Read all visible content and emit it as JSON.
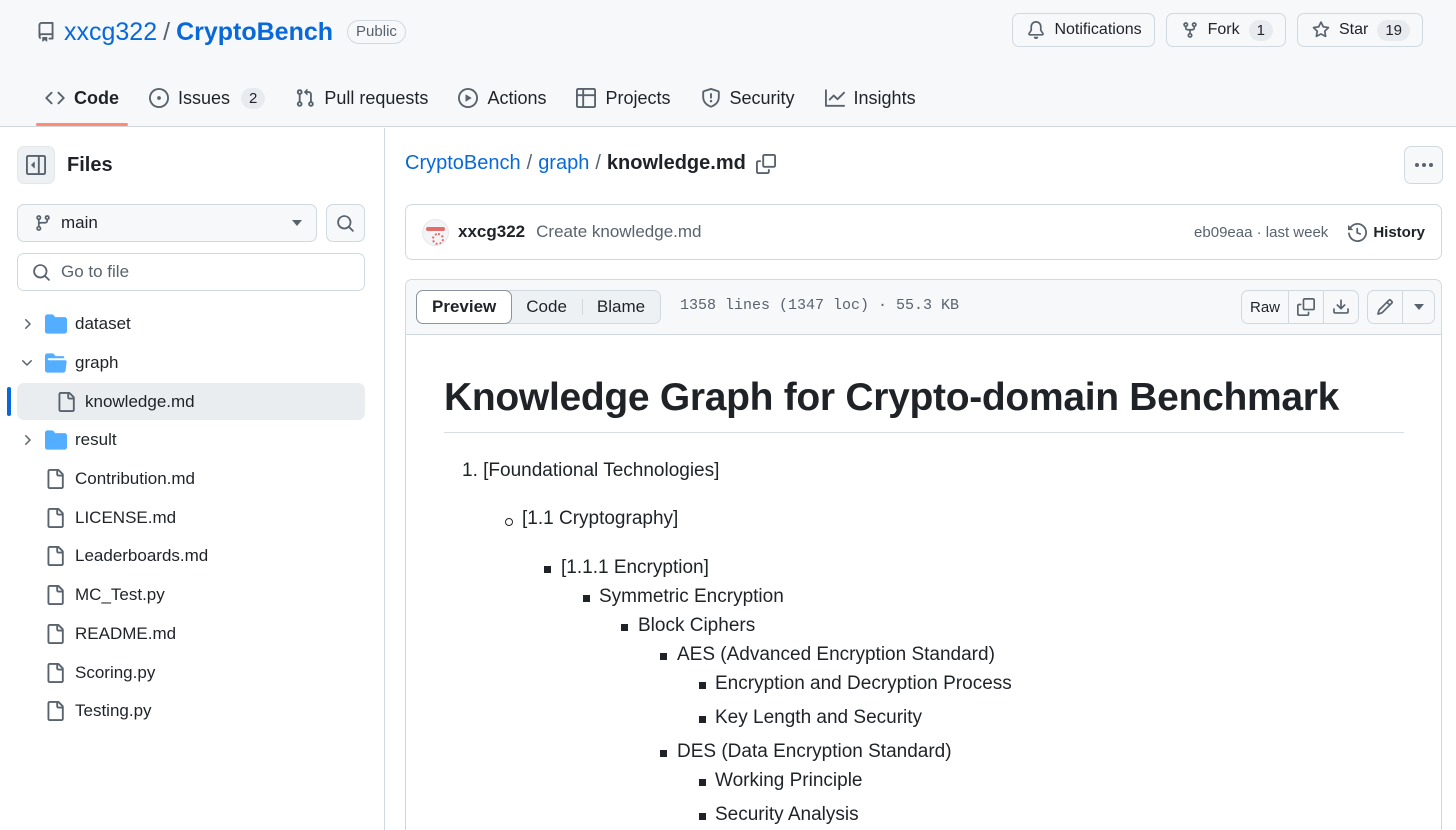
{
  "repo": {
    "owner": "xxcg322",
    "separator": "/",
    "name": "CryptoBench",
    "visibility": "Public"
  },
  "header_actions": {
    "notifications_label": "Notifications",
    "fork_label": "Fork",
    "fork_count": "1",
    "star_label": "Star",
    "star_count": "19"
  },
  "nav": {
    "tabs": [
      {
        "label": "Code",
        "icon": "code-icon",
        "selected": true
      },
      {
        "label": "Issues",
        "icon": "issue-opened-icon",
        "count": "2"
      },
      {
        "label": "Pull requests",
        "icon": "git-pull-request-icon"
      },
      {
        "label": "Actions",
        "icon": "play-icon"
      },
      {
        "label": "Projects",
        "icon": "table-icon"
      },
      {
        "label": "Security",
        "icon": "shield-icon"
      },
      {
        "label": "Insights",
        "icon": "graph-icon"
      }
    ]
  },
  "sidebar": {
    "title": "Files",
    "branch": "main",
    "goto_placeholder": "Go to file",
    "tree": [
      {
        "name": "dataset",
        "type": "folder",
        "expanded": false
      },
      {
        "name": "graph",
        "type": "folder",
        "expanded": true
      },
      {
        "name": "knowledge.md",
        "type": "file",
        "active": true,
        "nested": true
      },
      {
        "name": "result",
        "type": "folder",
        "expanded": false
      },
      {
        "name": "Contribution.md",
        "type": "file"
      },
      {
        "name": "LICENSE.md",
        "type": "file"
      },
      {
        "name": "Leaderboards.md",
        "type": "file"
      },
      {
        "name": "MC_Test.py",
        "type": "file"
      },
      {
        "name": "README.md",
        "type": "file"
      },
      {
        "name": "Scoring.py",
        "type": "file"
      },
      {
        "name": "Testing.py",
        "type": "file"
      }
    ]
  },
  "breadcrumb": {
    "repo": "CryptoBench",
    "folder": "graph",
    "file": "knowledge.md",
    "sep": "/"
  },
  "commit": {
    "author": "xxcg322",
    "message": "Create knowledge.md",
    "meta": "eb09eaa · last week",
    "history_label": "History"
  },
  "file_toolbar": {
    "tabs": [
      "Preview",
      "Code",
      "Blame"
    ],
    "selected_tab": "Preview",
    "info": "1358 lines (1347 loc) · 55.3 KB",
    "raw_label": "Raw"
  },
  "markdown": {
    "h1": "Knowledge Graph for Crypto-domain Benchmark",
    "items": [
      {
        "marker": "1.",
        "text": "[Foundational Technologies]"
      },
      {
        "marker": "circle",
        "text": "[1.1 Cryptography]"
      },
      {
        "marker": "square",
        "text": "[1.1.1 Encryption]"
      },
      {
        "marker": "square",
        "text": "Symmetric Encryption"
      },
      {
        "marker": "square",
        "text": "Block Ciphers"
      },
      {
        "marker": "square",
        "text": "AES (Advanced Encryption Standard)"
      },
      {
        "marker": "square",
        "text": "Encryption and Decryption Process"
      },
      {
        "marker": "square",
        "text": "Key Length and Security"
      },
      {
        "marker": "square",
        "text": "DES (Data Encryption Standard)"
      },
      {
        "marker": "square",
        "text": "Working Principle"
      },
      {
        "marker": "square",
        "text": "Security Analysis"
      }
    ]
  },
  "colors": {
    "link": "#0969da",
    "nav_underline": "#fd8c73",
    "folder": "#54aeff",
    "muted": "#59636e",
    "border": "#d1d9e0"
  }
}
